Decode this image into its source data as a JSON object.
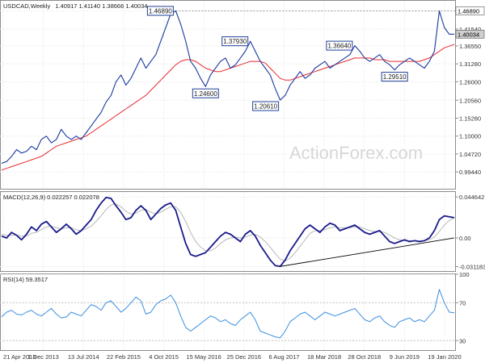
{
  "chart_data": [
    {
      "type": "line",
      "title": "USDCAD,Weekly",
      "ohlc_readout": "1.40917 1.41140 1.38666 1.40034",
      "x": [
        "21 Apr 2013",
        "1 Dec 2013",
        "13 Jul 2014",
        "22 Feb 2015",
        "4 Oct 2015",
        "15 May 2016",
        "25 Dec 2016",
        "6 Aug 2017",
        "18 Mar 2018",
        "28 Oct 2018",
        "9 Jun 2019",
        "19 Jan 2020"
      ],
      "ylim": [
        0.9448,
        1.4985
      ],
      "y_ticks": [
        "1.46890",
        "1.41540",
        "1.36550",
        "1.31280",
        "1.26000",
        "1.20560",
        "1.15280",
        "1.10000",
        "1.04720",
        "0.99440"
      ],
      "series": [
        {
          "values": [
            1.02,
            1.025,
            1.04,
            1.06,
            1.05,
            1.055,
            1.07,
            1.06,
            1.09,
            1.1,
            1.08,
            1.09,
            1.12,
            1.1,
            1.09,
            1.1,
            1.09,
            1.11,
            1.13,
            1.15,
            1.17,
            1.2,
            1.22,
            1.26,
            1.28,
            1.25,
            1.27,
            1.3,
            1.33,
            1.3,
            1.32,
            1.34,
            1.38,
            1.42,
            1.46,
            1.4689,
            1.43,
            1.38,
            1.32,
            1.3,
            1.27,
            1.246,
            1.28,
            1.3,
            1.32,
            1.33,
            1.3,
            1.31,
            1.33,
            1.35,
            1.3793,
            1.35,
            1.32,
            1.3,
            1.28,
            1.24,
            1.2061,
            1.22,
            1.25,
            1.27,
            1.29,
            1.27,
            1.28,
            1.3,
            1.31,
            1.32,
            1.3,
            1.31,
            1.32,
            1.33,
            1.34,
            1.3664,
            1.35,
            1.33,
            1.32,
            1.33,
            1.34,
            1.32,
            1.31,
            1.2951,
            1.31,
            1.32,
            1.33,
            1.32,
            1.31,
            1.3,
            1.32,
            1.35,
            1.4689,
            1.42,
            1.4,
            1.40034
          ]
        },
        {
          "values": [
            1.0,
            1.005,
            1.01,
            1.015,
            1.02,
            1.025,
            1.03,
            1.035,
            1.04,
            1.05,
            1.06,
            1.07,
            1.075,
            1.08,
            1.085,
            1.09,
            1.095,
            1.1,
            1.11,
            1.12,
            1.13,
            1.14,
            1.15,
            1.16,
            1.17,
            1.18,
            1.19,
            1.2,
            1.21,
            1.22,
            1.235,
            1.25,
            1.265,
            1.28,
            1.295,
            1.31,
            1.32,
            1.325,
            1.325,
            1.32,
            1.31,
            1.3,
            1.295,
            1.29,
            1.29,
            1.295,
            1.3,
            1.305,
            1.31,
            1.315,
            1.32,
            1.32,
            1.32,
            1.315,
            1.3,
            1.285,
            1.27,
            1.265,
            1.265,
            1.27,
            1.275,
            1.28,
            1.285,
            1.29,
            1.295,
            1.3,
            1.305,
            1.31,
            1.315,
            1.32,
            1.325,
            1.33,
            1.33,
            1.33,
            1.33,
            1.325,
            1.325,
            1.325,
            1.32,
            1.32,
            1.32,
            1.32,
            1.32,
            1.32,
            1.32,
            1.325,
            1.33,
            1.34,
            1.35,
            1.36,
            1.365,
            1.37
          ]
        }
      ],
      "annotations": [
        {
          "text": "1.46890",
          "x_index": 35,
          "y": 1.4689,
          "place": "left"
        },
        {
          "text": "1.24600",
          "x_index": 41,
          "y": 1.246,
          "place": "below"
        },
        {
          "text": "1.37930",
          "x_index": 50,
          "y": 1.3793,
          "place": "left"
        },
        {
          "text": "1.20610",
          "x_index": 56,
          "y": 1.2061,
          "place": "below-left"
        },
        {
          "text": "1.36640",
          "x_index": 71,
          "y": 1.3664,
          "place": "left"
        },
        {
          "text": "1.29510",
          "x_index": 79,
          "y": 1.2951,
          "place": "below"
        }
      ],
      "price_tags": [
        {
          "text": "1.46890",
          "y": 1.4689
        },
        {
          "text": "1.40034",
          "y": 1.40034
        }
      ],
      "watermark": "ActionForex.com",
      "colors": {
        "price": "#1a3a9e",
        "ma": "#e8292e",
        "tag_high": "#ffffff",
        "tag_last": "#cfcfcf"
      }
    },
    {
      "type": "line",
      "title": "MACD(12,26,9) 0.022257 0.022078",
      "ylim": [
        -0.036,
        0.05
      ],
      "y_ticks": [
        "0.044642",
        "0.00",
        "-0.031183"
      ],
      "series": [
        {
          "values": [
            0.002,
            0.0,
            0.006,
            0.003,
            -0.002,
            0.004,
            0.012,
            0.008,
            0.015,
            0.018,
            0.012,
            0.006,
            0.01,
            0.015,
            0.01,
            0.004,
            0.008,
            0.014,
            0.02,
            0.03,
            0.038,
            0.044,
            0.043,
            0.035,
            0.028,
            0.02,
            0.022,
            0.03,
            0.035,
            0.03,
            0.02,
            0.026,
            0.032,
            0.036,
            0.038,
            0.03,
            0.012,
            -0.006,
            -0.018,
            -0.02,
            -0.018,
            -0.016,
            -0.01,
            -0.004,
            0.002,
            0.006,
            0.004,
            0.0,
            -0.004,
            0.004,
            0.008,
            0.002,
            -0.008,
            -0.016,
            -0.024,
            -0.03,
            -0.031,
            -0.024,
            -0.014,
            -0.006,
            0.002,
            0.01,
            0.014,
            0.01,
            0.006,
            0.012,
            0.016,
            0.014,
            0.008,
            0.01,
            0.012,
            0.014,
            0.01,
            0.006,
            0.004,
            0.006,
            0.008,
            0.002,
            -0.004,
            -0.006,
            -0.004,
            -0.002,
            -0.004,
            -0.003,
            -0.004,
            -0.003,
            0.0,
            0.008,
            0.02,
            0.024,
            0.023,
            0.022
          ]
        },
        {
          "values": [
            0.004,
            0.003,
            0.003,
            0.003,
            0.002,
            0.002,
            0.005,
            0.006,
            0.009,
            0.012,
            0.013,
            0.011,
            0.01,
            0.011,
            0.011,
            0.009,
            0.008,
            0.01,
            0.013,
            0.018,
            0.024,
            0.031,
            0.036,
            0.037,
            0.034,
            0.029,
            0.026,
            0.027,
            0.03,
            0.031,
            0.028,
            0.026,
            0.028,
            0.031,
            0.034,
            0.034,
            0.028,
            0.018,
            0.006,
            -0.004,
            -0.01,
            -0.014,
            -0.014,
            -0.011,
            -0.006,
            -0.002,
            0.0,
            0.001,
            0.0,
            0.001,
            0.003,
            0.004,
            0.001,
            -0.004,
            -0.01,
            -0.017,
            -0.023,
            -0.025,
            -0.022,
            -0.016,
            -0.009,
            -0.002,
            0.005,
            0.008,
            0.008,
            0.009,
            0.011,
            0.012,
            0.011,
            0.011,
            0.011,
            0.012,
            0.012,
            0.01,
            0.008,
            0.007,
            0.007,
            0.006,
            0.003,
            0.0,
            -0.002,
            -0.003,
            -0.003,
            -0.003,
            -0.003,
            -0.003,
            -0.002,
            0.001,
            0.007,
            0.014,
            0.019,
            0.022
          ]
        }
      ],
      "trendline": {
        "from": {
          "x_index": 56,
          "y": -0.031
        },
        "to": {
          "x_index": 91,
          "y": 0.0
        }
      },
      "colors": {
        "macd": "#1a1a8c",
        "signal": "#b8b8b8",
        "trend": "#000000"
      }
    },
    {
      "type": "line",
      "title": "RSI(14) 59.3517",
      "ylim": [
        20,
        100
      ],
      "y_ticks": [
        "100",
        "70",
        "30",
        "0"
      ],
      "grid_levels": [
        70,
        30
      ],
      "series": [
        {
          "values": [
            55,
            60,
            62,
            58,
            57,
            60,
            62,
            58,
            56,
            60,
            64,
            58,
            54,
            55,
            60,
            58,
            56,
            62,
            68,
            66,
            62,
            70,
            72,
            66,
            60,
            64,
            70,
            76,
            72,
            58,
            60,
            68,
            72,
            74,
            78,
            70,
            56,
            44,
            40,
            44,
            48,
            52,
            56,
            54,
            50,
            52,
            48,
            46,
            52,
            56,
            60,
            52,
            40,
            38,
            36,
            34,
            33,
            40,
            50,
            54,
            58,
            60,
            56,
            52,
            56,
            60,
            58,
            56,
            58,
            60,
            62,
            64,
            58,
            52,
            50,
            54,
            56,
            50,
            46,
            44,
            50,
            52,
            54,
            50,
            52,
            50,
            56,
            62,
            84,
            70,
            60,
            59.35
          ]
        }
      ],
      "colors": {
        "rsi": "#3b8fe0"
      }
    }
  ]
}
